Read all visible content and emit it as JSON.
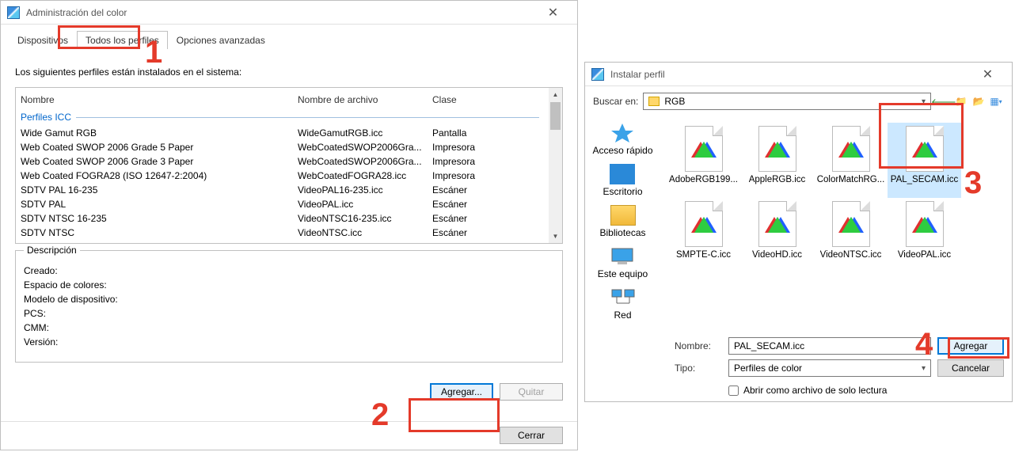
{
  "win1": {
    "title": "Administración del color",
    "tabs": [
      "Dispositivos",
      "Todos los perfiles",
      "Opciones avanzadas"
    ],
    "active_tab": 1,
    "intro": "Los siguientes perfiles están instalados en el sistema:",
    "columns": {
      "name": "Nombre",
      "file": "Nombre de archivo",
      "class": "Clase"
    },
    "section_label": "Perfiles ICC",
    "rows": [
      {
        "n": "Wide Gamut RGB",
        "a": "WideGamutRGB.icc",
        "c": "Pantalla"
      },
      {
        "n": "Web Coated SWOP 2006 Grade 5 Paper",
        "a": "WebCoatedSWOP2006Gra...",
        "c": "Impresora"
      },
      {
        "n": "Web Coated SWOP 2006 Grade 3 Paper",
        "a": "WebCoatedSWOP2006Gra...",
        "c": "Impresora"
      },
      {
        "n": "Web Coated FOGRA28 (ISO 12647-2:2004)",
        "a": "WebCoatedFOGRA28.icc",
        "c": "Impresora"
      },
      {
        "n": "SDTV PAL 16-235",
        "a": "VideoPAL16-235.icc",
        "c": "Escáner"
      },
      {
        "n": "SDTV PAL",
        "a": "VideoPAL.icc",
        "c": "Escáner"
      },
      {
        "n": "SDTV NTSC 16-235",
        "a": "VideoNTSC16-235.icc",
        "c": "Escáner"
      },
      {
        "n": "SDTV NTSC",
        "a": "VideoNTSC.icc",
        "c": "Escáner"
      }
    ],
    "desc": {
      "legend": "Descripción",
      "created": "Creado:",
      "colorspace": "Espacio de colores:",
      "devicemodel": "Modelo de dispositivo:",
      "pcs": "PCS:",
      "cmm": "CMM:",
      "version": "Versión:"
    },
    "btn_add": "Agregar...",
    "btn_remove": "Quitar",
    "btn_close": "Cerrar"
  },
  "win2": {
    "title": "Instalar perfil",
    "lookIn_label": "Buscar en:",
    "lookIn_value": "RGB",
    "places": [
      {
        "id": "quick",
        "label": "Acceso rápido"
      },
      {
        "id": "desktop",
        "label": "Escritorio"
      },
      {
        "id": "libs",
        "label": "Bibliotecas"
      },
      {
        "id": "pc",
        "label": "Este equipo"
      },
      {
        "id": "net",
        "label": "Red"
      }
    ],
    "files": [
      "AdobeRGB199...",
      "AppleRGB.icc",
      "ColorMatchRG...",
      "PAL_SECAM.icc",
      "SMPTE-C.icc",
      "VideoHD.icc",
      "VideoNTSC.icc",
      "VideoPAL.icc"
    ],
    "selected_index": 3,
    "name_label": "Nombre:",
    "name_value": "PAL_SECAM.icc",
    "type_label": "Tipo:",
    "type_value": "Perfiles de color",
    "readonly_label": "Abrir como archivo de solo lectura",
    "btn_add": "Agregar",
    "btn_cancel": "Cancelar"
  },
  "annotations": {
    "n1": "1",
    "n2": "2",
    "n3": "3",
    "n4": "4"
  }
}
